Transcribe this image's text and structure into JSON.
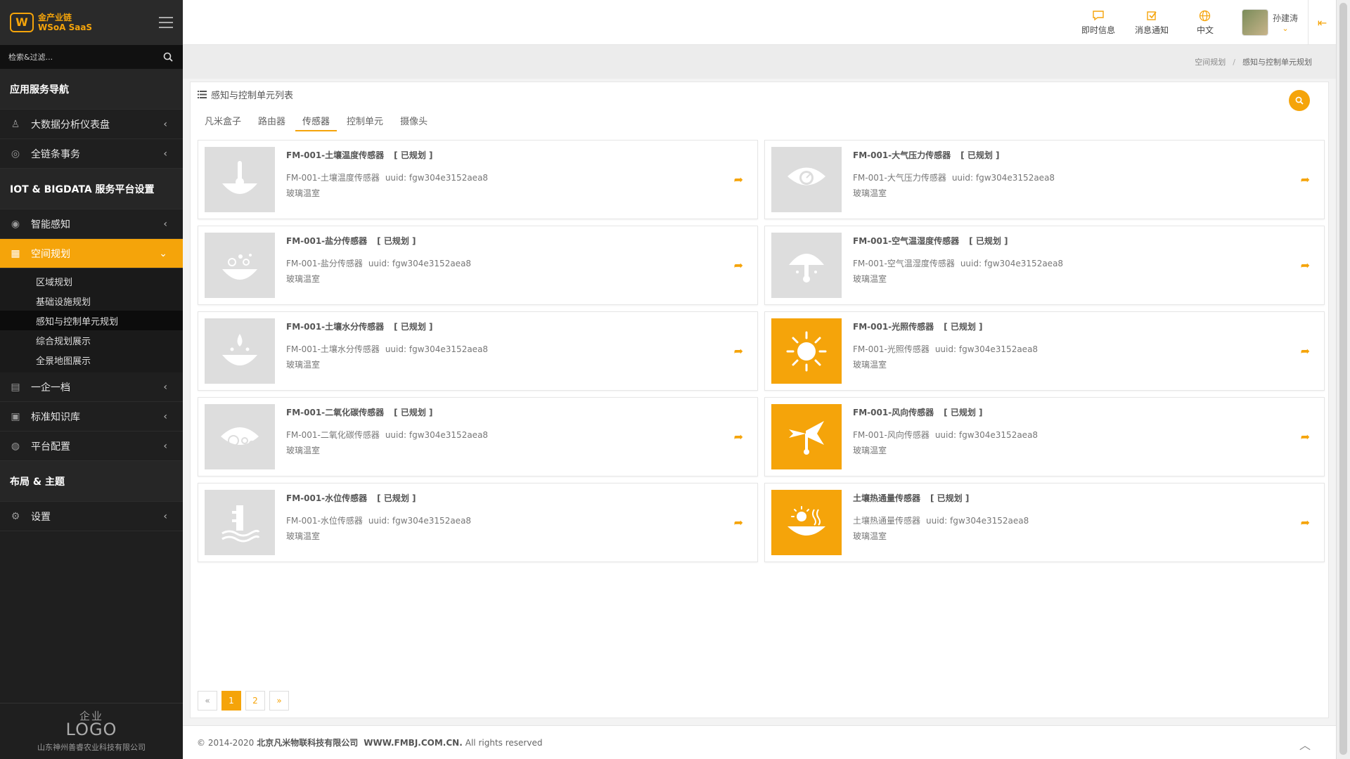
{
  "brand": {
    "line1": "金产业链",
    "line2": "WSoA SaaS",
    "mark": "W"
  },
  "sidebar": {
    "search_placeholder": "检索&过滤...",
    "sections": {
      "app_nav": "应用服务导航",
      "iot": "IOT & BIGDATA 服务平台设置",
      "layout": "布局 & 主题"
    },
    "items": {
      "bigdata": "大数据分析仪表盘",
      "chain": "全链条事务",
      "sensing": "智能感知",
      "space": "空间规划",
      "enterprise": "一企一档",
      "knowledge": "标准知识库",
      "platform": "平台配置",
      "settings": "设置"
    },
    "sub_items": [
      "区域规划",
      "基础设施规划",
      "感知与控制单元规划",
      "综合规划展示",
      "全景地图展示"
    ],
    "bottom": {
      "line1": "企业",
      "line2": "LOGO",
      "company": "山东神州善睿农业科技有限公司"
    }
  },
  "topbar": {
    "instant_msg": "即时信息",
    "notifications": "消息通知",
    "language": "中文",
    "user_name": "孙建涛"
  },
  "breadcrumb": {
    "parent": "空间规划",
    "current": "感知与控制单元规划"
  },
  "panel": {
    "title": "感知与控制单元列表",
    "tabs": [
      "凡米盒子",
      "路由器",
      "传感器",
      "控制单元",
      "摄像头"
    ],
    "active_tab": "传感器"
  },
  "cards": [
    {
      "title": "FM-001-土壤温度传感器",
      "status": "[ 已规划 ]",
      "desc": "FM-001-土壤温度传感器",
      "uuid": "uuid: fgw304e3152aea8",
      "loc": "玻璃温室",
      "icon": "soil-temperature-icon",
      "active": false
    },
    {
      "title": "FM-001-大气压力传感器",
      "status": "[ 已规划 ]",
      "desc": "FM-001-大气压力传感器",
      "uuid": "uuid: fgw304e3152aea8",
      "loc": "玻璃温室",
      "icon": "air-pressure-icon",
      "active": false
    },
    {
      "title": "FM-001-盐分传感器",
      "status": "[ 已规划 ]",
      "desc": "FM-001-盐分传感器",
      "uuid": "uuid: fgw304e3152aea8",
      "loc": "玻璃温室",
      "icon": "salinity-icon",
      "active": false
    },
    {
      "title": "FM-001-空气温湿度传感器",
      "status": "[ 已规划 ]",
      "desc": "FM-001-空气温湿度传感器",
      "uuid": "uuid: fgw304e3152aea8",
      "loc": "玻璃温室",
      "icon": "air-humidity-icon",
      "active": false
    },
    {
      "title": "FM-001-土壤水分传感器",
      "status": "[ 已规划 ]",
      "desc": "FM-001-土壤水分传感器",
      "uuid": "uuid: fgw304e3152aea8",
      "loc": "玻璃温室",
      "icon": "soil-moisture-icon",
      "active": false
    },
    {
      "title": "FM-001-光照传感器",
      "status": "[ 已规划 ]",
      "desc": "FM-001-光照传感器",
      "uuid": "uuid: fgw304e3152aea8",
      "loc": "玻璃温室",
      "icon": "sun-icon",
      "active": true
    },
    {
      "title": "FM-001-二氧化碳传感器",
      "status": "[ 已规划 ]",
      "desc": "FM-001-二氧化碳传感器",
      "uuid": "uuid: fgw304e3152aea8",
      "loc": "玻璃温室",
      "icon": "co2-icon",
      "active": false
    },
    {
      "title": "FM-001-风向传感器",
      "status": "[ 已规划 ]",
      "desc": "FM-001-风向传感器",
      "uuid": "uuid: fgw304e3152aea8",
      "loc": "玻璃温室",
      "icon": "wind-vane-icon",
      "active": true
    },
    {
      "title": "FM-001-水位传感器",
      "status": "[ 已规划 ]",
      "desc": "FM-001-水位传感器",
      "uuid": "uuid: fgw304e3152aea8",
      "loc": "玻璃温室",
      "icon": "water-level-icon",
      "active": false
    },
    {
      "title": "土壤热通量传感器",
      "status": "[ 已规划 ]",
      "desc": "土壤热通量传感器",
      "uuid": "uuid: fgw304e3152aea8",
      "loc": "玻璃温室",
      "icon": "soil-heat-flux-icon",
      "active": true
    }
  ],
  "pager": {
    "prev": "«",
    "pages": [
      "1",
      "2"
    ],
    "next": "»",
    "current": "1"
  },
  "footer": {
    "prefix": "© 2014-2020",
    "company": "北京凡米物联科技有限公司",
    "site": "WWW.FMBJ.COM.CN.",
    "suffix": "All rights reserved"
  },
  "colors": {
    "accent": "#f5a40a",
    "sidebar": "#1f1f1f",
    "placeholder_tile": "#dddddd"
  }
}
